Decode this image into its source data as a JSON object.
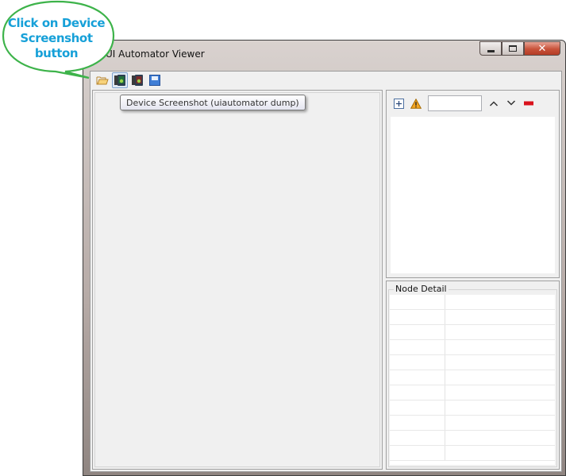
{
  "window": {
    "title": "UI Automator Viewer",
    "caption_buttons": {
      "minimize": "minimize-icon",
      "maximize": "maximize-icon",
      "close": "close-icon"
    }
  },
  "toolbar": {
    "buttons": [
      {
        "name": "open",
        "icon": "folder-open-icon"
      },
      {
        "name": "device-screenshot",
        "icon": "device-screenshot-icon",
        "active": true
      },
      {
        "name": "device-screenshot-compressed",
        "icon": "device-screenshot-compressed-icon"
      },
      {
        "name": "save",
        "icon": "save-icon"
      }
    ]
  },
  "tooltip": {
    "text": "Device Screenshot (uiautomator dump)"
  },
  "tree_panel": {
    "icons": [
      "expand-all-icon",
      "warning-icon",
      "up-arrow-icon",
      "down-arrow-icon",
      "clear-icon"
    ],
    "search_value": ""
  },
  "node_detail": {
    "label": "Node Detail",
    "rows": 11
  },
  "callout": {
    "line1": "Click on Device",
    "line2": "Screenshot",
    "line3": "button",
    "color": "#16a0d8",
    "border_color": "#3db34a"
  }
}
